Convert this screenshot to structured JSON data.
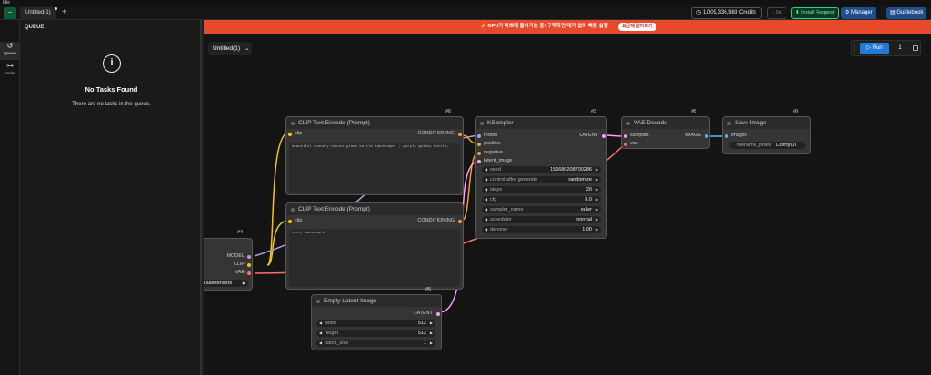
{
  "titlebar": {
    "title": "Idle"
  },
  "topbar": {
    "tab_label": "Untitled(1)",
    "plus": "+",
    "logo": "~",
    "credits": "1,009,336,983 Credits",
    "timer": "0s",
    "install_request": "Install Request",
    "manager": "Manager",
    "guidebook": "Guidebook"
  },
  "rail": {
    "queue_label": "Queue",
    "nodes_label": "Nodes"
  },
  "queue_panel": {
    "title": "QUEUE",
    "empty_title": "No Tasks Found",
    "empty_sub": "There are no tasks in the queue."
  },
  "banner": {
    "message": "GPU가 바쁘게 돌아가는 중! 구독하면 대기 없이 빠른 실행",
    "button": "요금제 알아보기"
  },
  "canvas": {
    "workflow_select": "Untitled(1)",
    "run_label": "Run",
    "run_count": "1"
  },
  "nodes": {
    "clip1": {
      "id": "#6",
      "title": "CLIP Text Encode (Prompt)",
      "in": "clip",
      "out": "CONDITIONING",
      "text": "beautiful scenery nature glass bottle landscape, , purple galaxy bottle,"
    },
    "clip2": {
      "id": "",
      "title": "CLIP Text Encode (Prompt)",
      "in": "clip",
      "out": "CONDITIONING",
      "text": "text, watermark"
    },
    "ksampler": {
      "id": "#3",
      "title": "KSampler",
      "inputs": [
        "model",
        "positive",
        "negative",
        "latent_image"
      ],
      "out": "LATENT",
      "widgets": [
        {
          "label": "seed",
          "value": "156680208700286"
        },
        {
          "label": "control after generate",
          "value": "randomize"
        },
        {
          "label": "steps",
          "value": "20"
        },
        {
          "label": "cfg",
          "value": "8.0"
        },
        {
          "label": "sampler_name",
          "value": "euler"
        },
        {
          "label": "scheduler",
          "value": "normal"
        },
        {
          "label": "denoise",
          "value": "1.00"
        }
      ]
    },
    "vae": {
      "id": "#8",
      "title": "VAE Decode",
      "inputs": [
        "samples",
        "vae"
      ],
      "out": "IMAGE"
    },
    "save": {
      "id": "#9",
      "title": "Save Image",
      "in": "images",
      "widget_label": "filename_prefix",
      "widget_value": "ComfyUI"
    },
    "checkpoint": {
      "id": "#4",
      "outs": [
        "MODEL",
        "CLIP",
        "VAE"
      ],
      "ckpt": "l.safetensors"
    },
    "latent": {
      "id": "#5",
      "title": "Empty Latent Image",
      "out": "LATENT",
      "widgets": [
        {
          "label": "width",
          "value": "512"
        },
        {
          "label": "height",
          "value": "512"
        },
        {
          "label": "batch_size",
          "value": "1"
        }
      ]
    }
  },
  "colors": {
    "banner": "#e8492b",
    "clip_wire": "#f5c31a",
    "conditioning_wire": "#f0a030",
    "model_wire": "#b39ddb",
    "latent_wire": "#ff9cf9",
    "vae_wire": "#ff6e6e",
    "image_wire": "#64b5f6"
  }
}
